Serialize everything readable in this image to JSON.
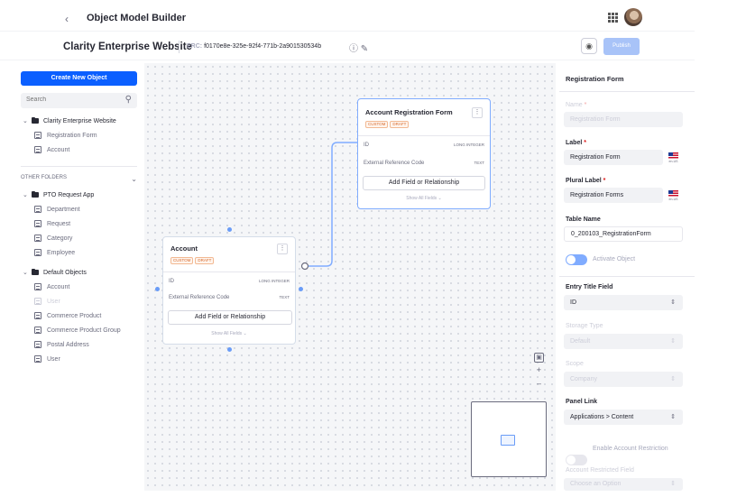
{
  "header": {
    "app_title": "Object Model Builder",
    "project_title": "Clarity Enterprise Website",
    "erc_label": "ERC:",
    "erc_value": "f0170e8e-325e-92f4-771b-2a901530534b",
    "publish_label": "Publish"
  },
  "sidebar": {
    "create_label": "Create New Object",
    "search_placeholder": "Search",
    "project_folder": {
      "label": "Clarity Enterprise Website",
      "items": [
        "Registration Form",
        "Account"
      ]
    },
    "other_folders_label": "OTHER FOLDERS",
    "folders": [
      {
        "label": "PTO Request App",
        "items": [
          "Department",
          "Request",
          "Category",
          "Employee"
        ]
      },
      {
        "label": "Default Objects",
        "items": [
          "Account",
          "User",
          "Commerce Product",
          "Commerce Product Group",
          "Postal Address",
          "User"
        ]
      }
    ]
  },
  "canvas": {
    "account_card": {
      "title": "Account",
      "badges": [
        "CUSTOM",
        "DRAFT"
      ],
      "fields": [
        {
          "name": "ID",
          "type": "LONG INTEGER"
        },
        {
          "name": "External Reference Code",
          "type": "TEXT"
        }
      ],
      "add_field_label": "Add Field or Relationship",
      "show_all_label": "Show All Fields"
    },
    "registration_card": {
      "title": "Account Registration Form",
      "badges": [
        "CUSTOM",
        "DRAFT"
      ],
      "fields": [
        {
          "name": "ID",
          "type": "LONG INTEGER"
        },
        {
          "name": "External Reference Code",
          "type": "TEXT"
        }
      ],
      "add_field_label": "Add Field or Relationship",
      "show_all_label": "Show All Fields"
    }
  },
  "panel": {
    "title": "Registration Form",
    "name_label": "Name",
    "name_value": "Registration Form",
    "label_label": "Label",
    "label_value": "Registration Form",
    "plural_label": "Plural Label",
    "plural_value": "Registration Forms",
    "flag_code": "en-US",
    "table_name_label": "Table Name",
    "table_name_value": "0_200103_RegistrationForm",
    "activate_label": "Activate Object",
    "entry_title_label": "Entry Title Field",
    "entry_title_value": "ID",
    "storage_type_label": "Storage Type",
    "storage_type_value": "Default",
    "scope_label": "Scope",
    "scope_value": "Company",
    "panel_link_label": "Panel Link",
    "panel_link_value": "Applications > Content",
    "account_restriction_label": "Enable Account Restriction",
    "restricted_field_label": "Account Restricted Field",
    "restricted_field_value": "Choose an Option"
  },
  "colors": {
    "primary": "#0b5fff",
    "accent_light": "#80acff",
    "badge": "#d66a2e"
  }
}
